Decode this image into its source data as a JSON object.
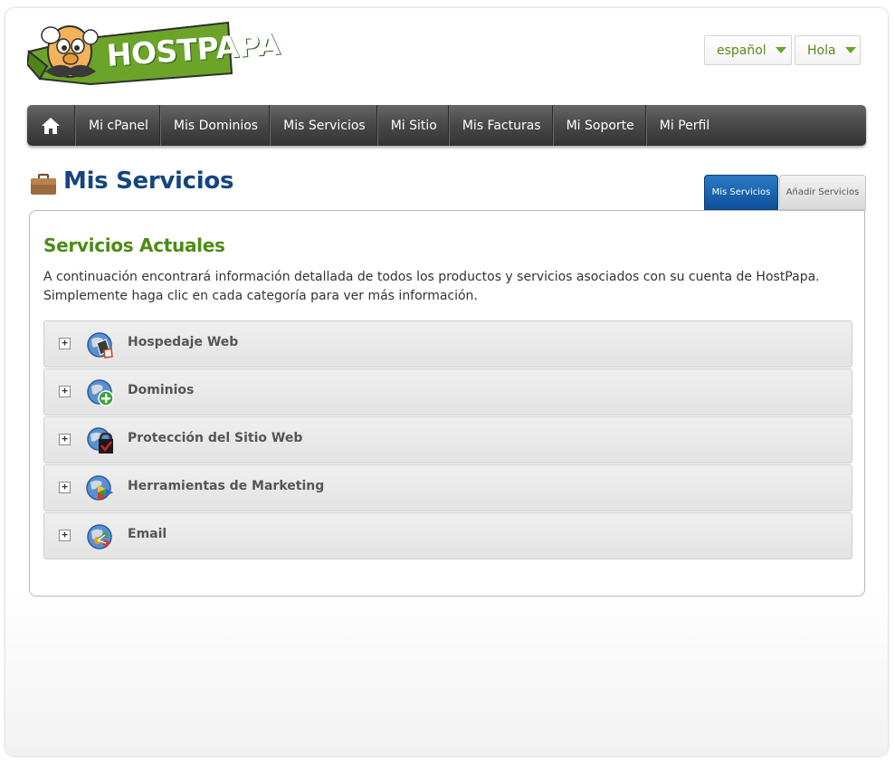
{
  "header": {
    "logo_text": "HOSTPAPA",
    "language_label": "español",
    "user_label": "Hola"
  },
  "nav": {
    "items": [
      {
        "label": "Mi cPanel"
      },
      {
        "label": "Mis Dominios"
      },
      {
        "label": "Mis Servicios"
      },
      {
        "label": "Mi Sitio"
      },
      {
        "label": "Mis Facturas"
      },
      {
        "label": "Mi Soporte"
      },
      {
        "label": "Mi Perfil"
      }
    ]
  },
  "page": {
    "title": "Mis Servicios"
  },
  "tabs": [
    {
      "label": "Mis Servicios",
      "active": true
    },
    {
      "label": "Añadir Servicios",
      "active": false
    }
  ],
  "content": {
    "section_title": "Servicios Actuales",
    "description_line1": "A continuación encontrará información detallada de todos los productos y servicios asociados con su cuenta de HostPapa.",
    "description_line2": "Simplemente haga clic en cada categoría para ver más información.",
    "services": [
      {
        "label": "Hospedaje Web",
        "icon": "web-hosting-icon"
      },
      {
        "label": "Dominios",
        "icon": "domains-icon"
      },
      {
        "label": "Protección del Sitio Web",
        "icon": "site-protection-icon"
      },
      {
        "label": "Herramientas de Marketing",
        "icon": "marketing-tools-icon"
      },
      {
        "label": "Email",
        "icon": "email-icon"
      }
    ],
    "expand_symbol": "+"
  },
  "colors": {
    "brand_green": "#6ba428",
    "title_blue": "#14457f",
    "section_green": "#4d8a14",
    "tab_active": "#0d4f99"
  }
}
